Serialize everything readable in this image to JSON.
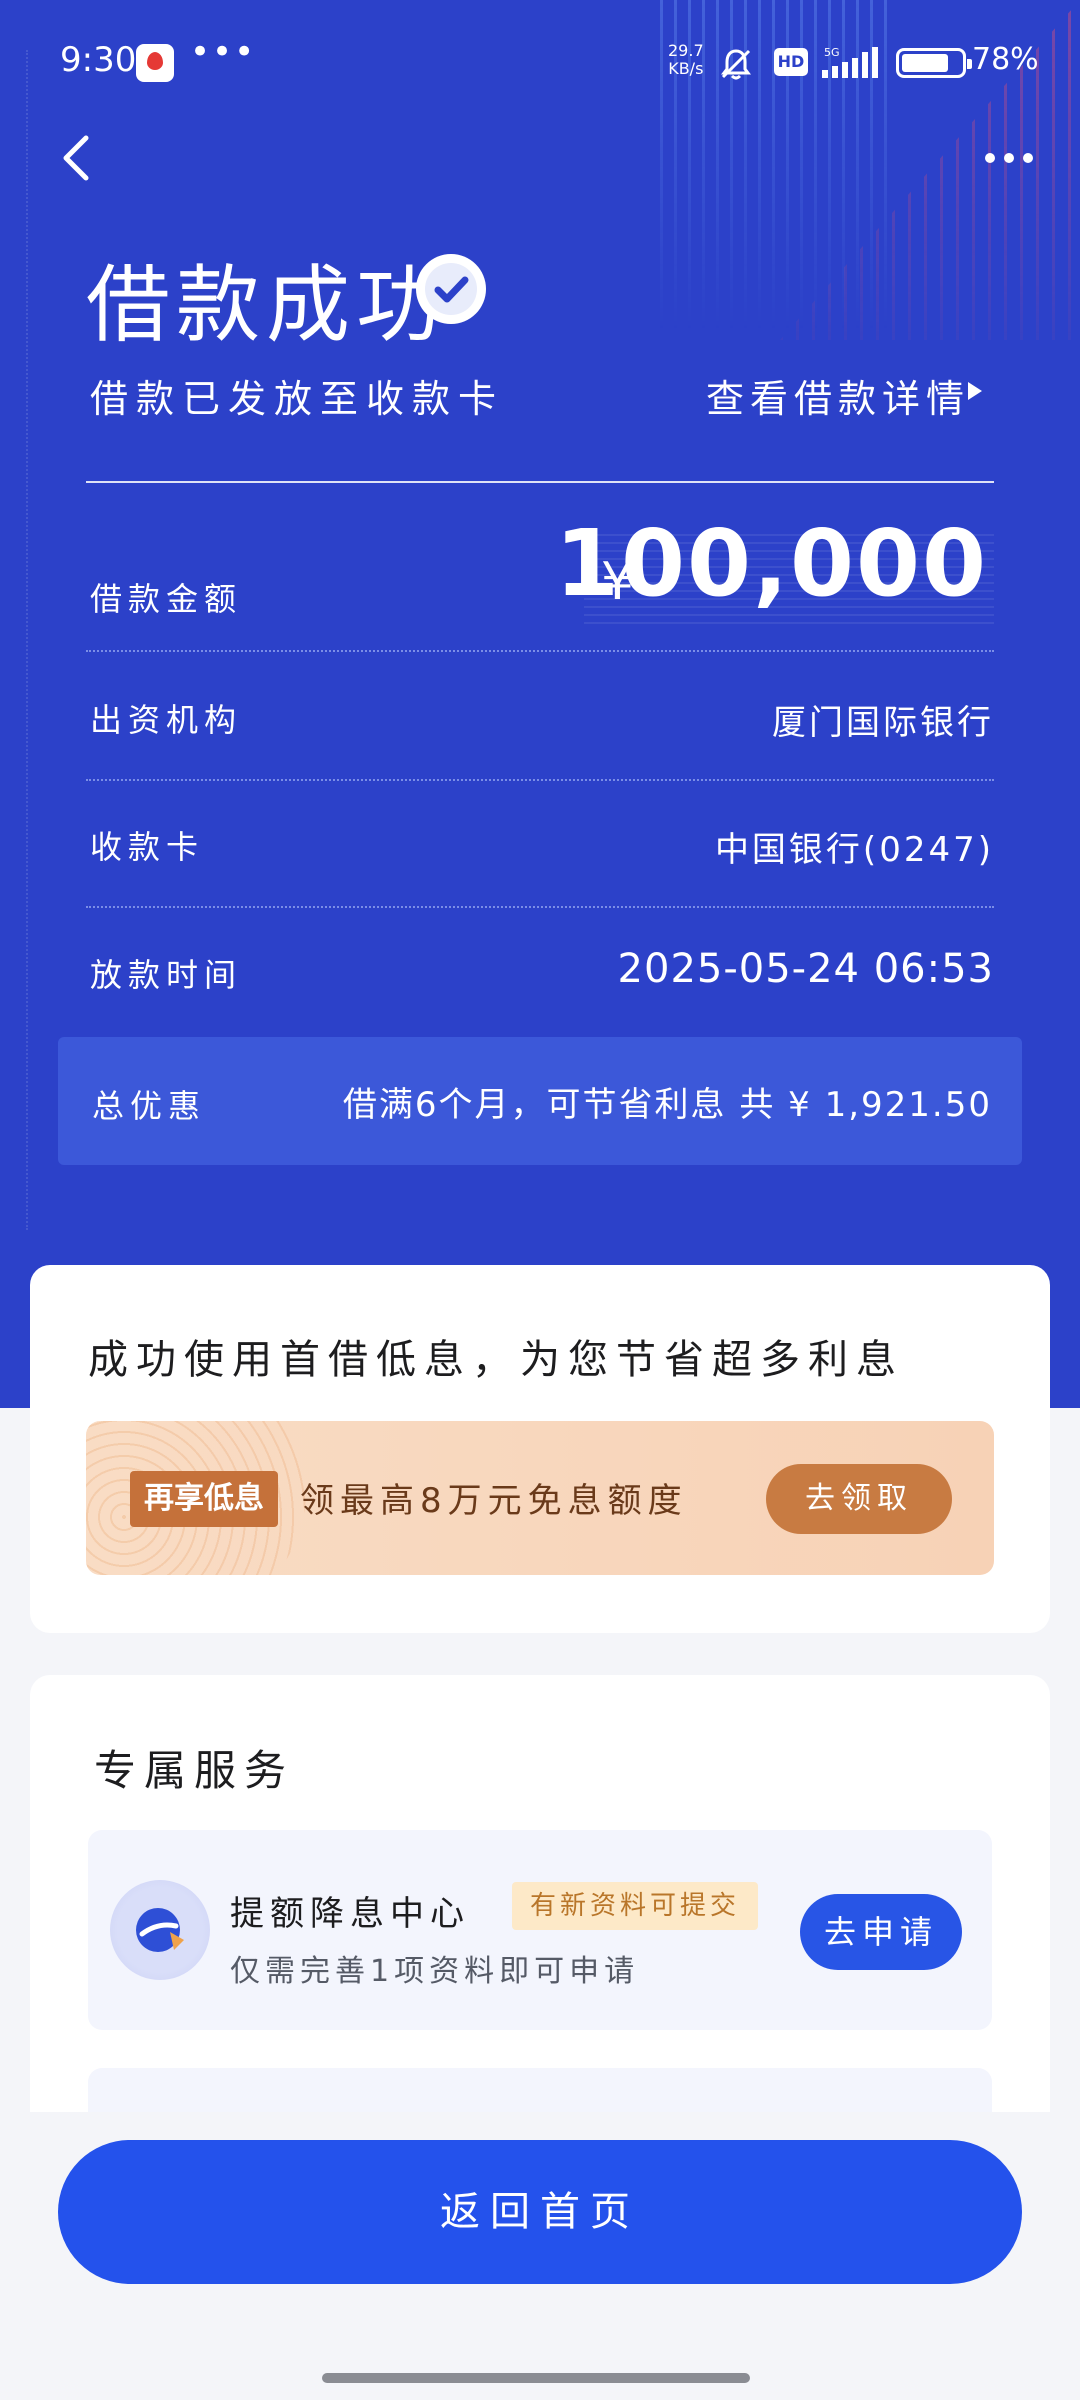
{
  "status_bar": {
    "time": "9:30",
    "more_dots": "•••",
    "net_speed_top": "29.7",
    "net_speed_bottom": "KB/s",
    "hd_label": "HD",
    "network_type": "5G",
    "battery": "78%",
    "battery_level": 0.78
  },
  "header": {
    "title": "借款成功",
    "subtitle": "借款已发放至收款卡",
    "detail_link": "查看借款详情"
  },
  "loan_details": {
    "amount_label": "借款金额",
    "amount_currency": "¥",
    "amount_value": "100,000",
    "lender_label": "出资机构",
    "lender_value": "厦门国际银行",
    "card_label": "收款卡",
    "card_value": "中国银行(0247)",
    "time_label": "放款时间",
    "time_value": "2025-05-24 06:53",
    "discount_label": "总优惠",
    "discount_value": "借满6个月，可节省利息 共 ¥ 1,921.50"
  },
  "promo": {
    "heading": "成功使用首借低息，为您节省超多利息",
    "tag": "再享低息",
    "text": "领最高8万元免息额度",
    "button": "去领取"
  },
  "services": {
    "heading": "专属服务",
    "items": [
      {
        "title": "提额降息中心",
        "badge": "有新资料可提交",
        "subtitle": "仅需完善1项资料即可申请",
        "button": "去申请"
      }
    ]
  },
  "footer": {
    "home_button": "返回首页"
  },
  "colors": {
    "hero_blue": "#2c41c9",
    "band_blue": "#3c58d9",
    "primary_button": "#2452ec",
    "promo_orange": "#c87b42"
  }
}
